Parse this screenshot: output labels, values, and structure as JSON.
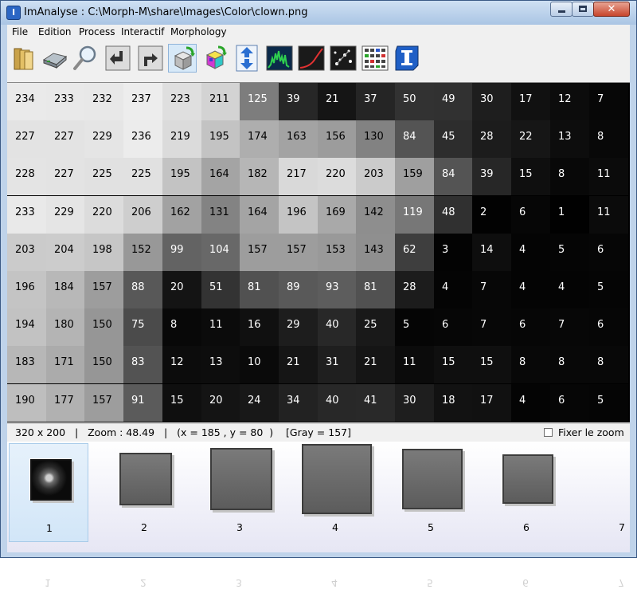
{
  "window": {
    "title": "ImAnalyse : C:\\Morph-M\\share\\Images\\Color\\clown.png",
    "app_icon_letter": "I",
    "close_glyph": "✕"
  },
  "menu": [
    "File",
    "Edition",
    "Process",
    "Interactif",
    "Morphology"
  ],
  "toolbar": {
    "icons": [
      "open-folder-icon",
      "save-disk-icon",
      "zoom-magnifier-icon",
      "undo-arrow-icon",
      "redo-arrow-icon",
      "color-cube-transfer-icon",
      "rgb-cube-icon",
      "up-down-arrows-icon",
      "histogram-icon",
      "curve-profile-icon",
      "points-scatter-icon",
      "pixel-grid-icon",
      "info-i-icon"
    ],
    "pressed_index": 5
  },
  "grid": {
    "rows": [
      [
        234,
        233,
        232,
        237,
        223,
        211,
        125,
        39,
        21,
        37,
        50,
        49,
        30,
        17,
        12,
        7
      ],
      [
        227,
        227,
        229,
        236,
        219,
        195,
        174,
        163,
        156,
        130,
        84,
        45,
        28,
        22,
        13,
        8
      ],
      [
        228,
        227,
        225,
        225,
        195,
        164,
        182,
        217,
        220,
        203,
        159,
        84,
        39,
        15,
        8,
        11
      ],
      [
        233,
        229,
        220,
        206,
        162,
        131,
        164,
        196,
        169,
        142,
        119,
        48,
        2,
        6,
        1,
        11
      ],
      [
        203,
        204,
        198,
        152,
        99,
        104,
        157,
        157,
        153,
        143,
        62,
        3,
        14,
        4,
        5,
        6
      ],
      [
        196,
        184,
        157,
        88,
        20,
        51,
        81,
        89,
        93,
        81,
        28,
        4,
        7,
        4,
        4,
        5
      ],
      [
        194,
        180,
        150,
        75,
        8,
        11,
        16,
        29,
        40,
        25,
        5,
        6,
        7,
        6,
        7,
        6
      ],
      [
        183,
        171,
        150,
        83,
        12,
        13,
        10,
        21,
        31,
        21,
        11,
        15,
        15,
        8,
        8,
        8
      ],
      [
        190,
        177,
        157,
        91,
        15,
        20,
        24,
        34,
        40,
        41,
        30,
        18,
        17,
        4,
        6,
        5
      ]
    ]
  },
  "status": {
    "text": "320 x 200   |   Zoom : 48.49   |   (x = 185 , y = 80  )    [Gray = 157]",
    "fix_zoom_label": "Fixer le zoom"
  },
  "thumbnails": [
    {
      "label": "1",
      "selected": true
    },
    {
      "label": "2",
      "selected": false
    },
    {
      "label": "3",
      "selected": false
    },
    {
      "label": "4",
      "selected": false
    },
    {
      "label": "5",
      "selected": false
    },
    {
      "label": "6",
      "selected": false
    },
    {
      "label": "7",
      "selected": false
    }
  ],
  "colors": {
    "titlebar": "#bfd3ea",
    "selected_thumb": "#d2e6f8"
  }
}
